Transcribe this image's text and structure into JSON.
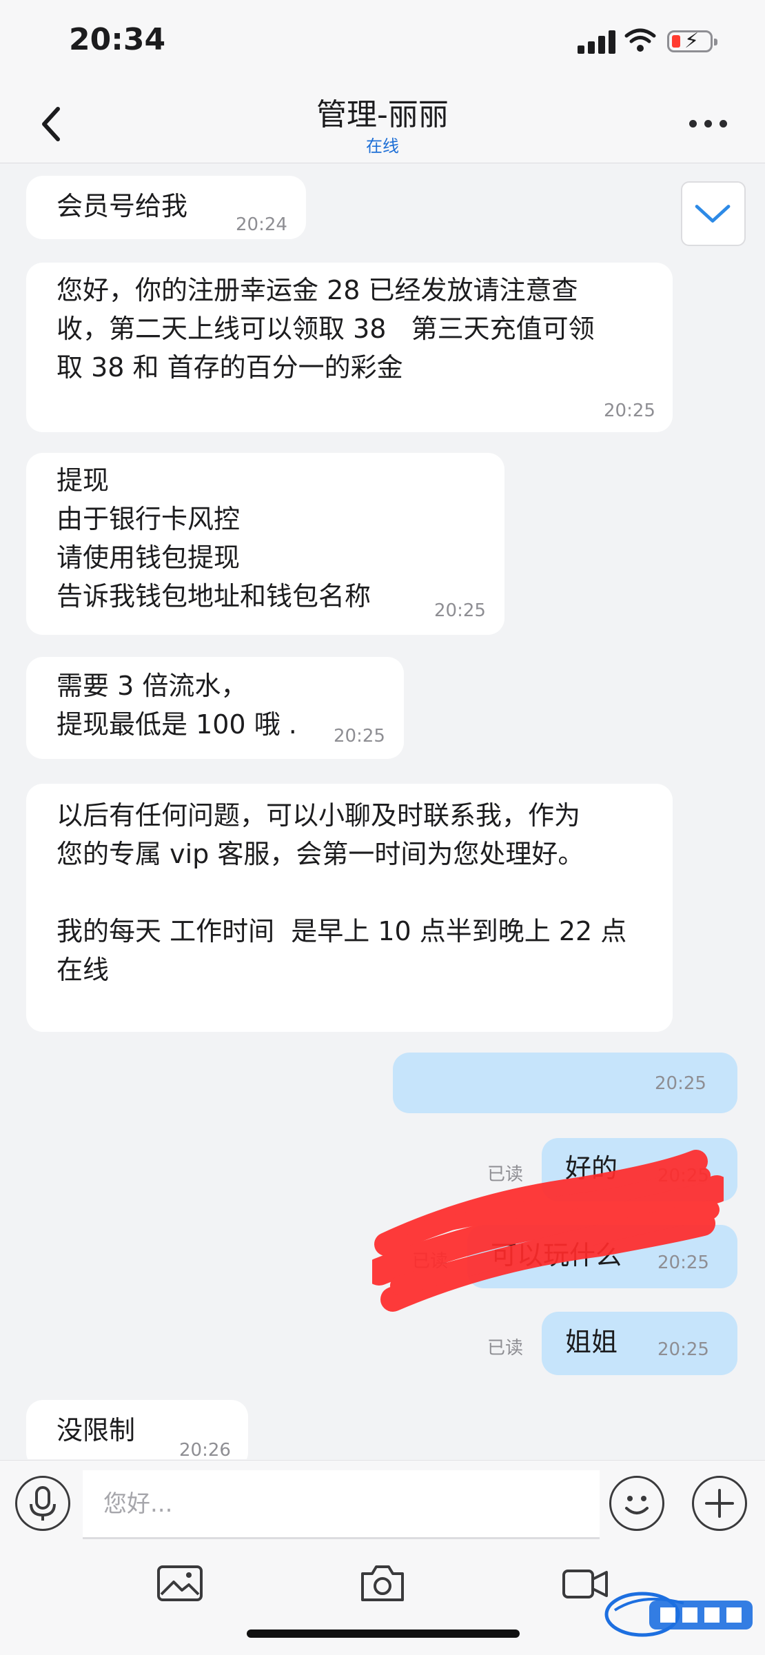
{
  "status_bar": {
    "time": "20:34"
  },
  "header": {
    "title": "管理-丽丽",
    "subtitle": "在线"
  },
  "messages": [
    {
      "dir": "in",
      "text": "会员号给我",
      "time": "20:24"
    },
    {
      "dir": "in",
      "text": "您好，你的注册幸运金 28 已经发放请注意查\n收，第二天上线可以领取 38   第三天充值可领\n取 38 和 首存的百分一的彩金",
      "time": "20:25"
    },
    {
      "dir": "in",
      "text": "提现\n由于银行卡风控\n请使用钱包提现\n告诉我钱包地址和钱包名称",
      "time": "20:25"
    },
    {
      "dir": "in",
      "text": "需要 3 倍流水，\n提现最低是 100 哦 .",
      "time": "20:25"
    },
    {
      "dir": "in",
      "text": "以后有任何问题，可以小聊及时联系我，作为\n您的专属 vip 客服，会第一时间为您处理好。\n\n我的每天 工作时间  是早上 10 点半到晚上 22 点\n在线",
      "time": ""
    },
    {
      "dir": "out",
      "text": "",
      "time": "20:25",
      "redacted": true
    },
    {
      "dir": "out",
      "text": "好的",
      "time": "20:25",
      "read": "已读"
    },
    {
      "dir": "out",
      "text": "可以玩什么",
      "time": "20:25",
      "read": "已读"
    },
    {
      "dir": "out",
      "text": "姐姐",
      "time": "20:25",
      "read": "已读"
    },
    {
      "dir": "in",
      "text": "没限制",
      "time": "20:26"
    }
  ],
  "input": {
    "placeholder": "您好..."
  },
  "icons": {
    "back": "chevron-left-icon",
    "more": "more-dots-icon",
    "scroll_down": "chevron-down-icon",
    "mic": "microphone-icon",
    "emoji": "emoji-icon",
    "plus": "plus-icon",
    "image": "image-icon",
    "camera": "camera-icon",
    "video": "video-icon"
  },
  "colors": {
    "accent": "#1e6fd6",
    "outgoing_bubble": "#c6e4fb",
    "incoming_bubble": "#ffffff",
    "background": "#f2f3f5",
    "scribble": "#ff2b2b"
  }
}
